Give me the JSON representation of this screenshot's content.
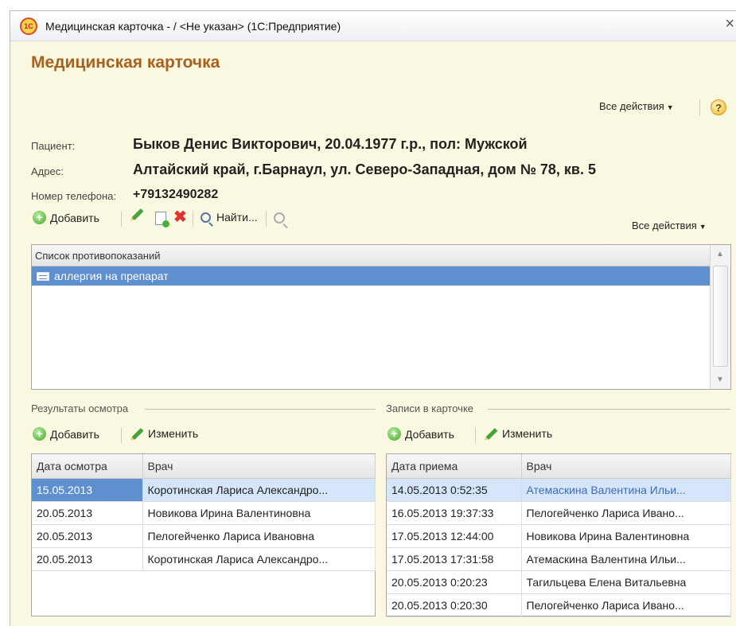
{
  "window": {
    "title": "Медицинская карточка - / <Не указан> (1С:Предприятие)",
    "app_icon": "1С",
    "close_glyph": "×"
  },
  "form": {
    "title": "Медицинская карточка",
    "all_actions": "Все действия",
    "help": "?"
  },
  "patient": {
    "patient_label": "Пациент:",
    "patient_value": "Быков Денис Викторович, 20.04.1977 г.р., пол: Мужской",
    "address_label": "Адрес:",
    "address_value": "Алтайский край, г.Барнаул, ул. Северо-Западная, дом № 78, кв. 5",
    "phone_label": "Номер телефона:",
    "phone_value": "+79132490282"
  },
  "list_toolbar": {
    "add": "Добавить",
    "find": "Найти...",
    "all_actions": "Все действия"
  },
  "contraindications": {
    "header": "Список противопоказаний",
    "items": [
      "аллергия на препарат"
    ]
  },
  "exam_results": {
    "group_title": "Результаты осмотра",
    "add": "Добавить",
    "edit": "Изменить",
    "columns": [
      "Дата осмотра",
      "Врач"
    ],
    "rows": [
      [
        "15.05.2013",
        "Коротинская Лариса Александро..."
      ],
      [
        "20.05.2013",
        "Новикова Ирина Валентиновна"
      ],
      [
        "20.05.2013",
        "Пелогейченко Лариса Ивановна"
      ],
      [
        "20.05.2013",
        "Коротинская Лариса Александро..."
      ]
    ]
  },
  "card_records": {
    "group_title": "Записи в карточке",
    "add": "Добавить",
    "edit": "Изменить",
    "columns": [
      "Дата приема",
      "Врач"
    ],
    "rows": [
      [
        "14.05.2013 0:52:35",
        "Атемаскина Валентина Ильи..."
      ],
      [
        "16.05.2013 19:37:33",
        "Пелогейченко Лариса Ивано..."
      ],
      [
        "17.05.2013 12:44:00",
        "Новикова Ирина Валентиновна"
      ],
      [
        "17.05.2013 17:31:58",
        "Атемаскина Валентина Ильи..."
      ],
      [
        "20.05.2013 0:20:23",
        "Тагильцева Елена Витальевна"
      ],
      [
        "20.05.2013 0:20:30",
        "Пелогейченко Лариса Ивано..."
      ]
    ]
  }
}
